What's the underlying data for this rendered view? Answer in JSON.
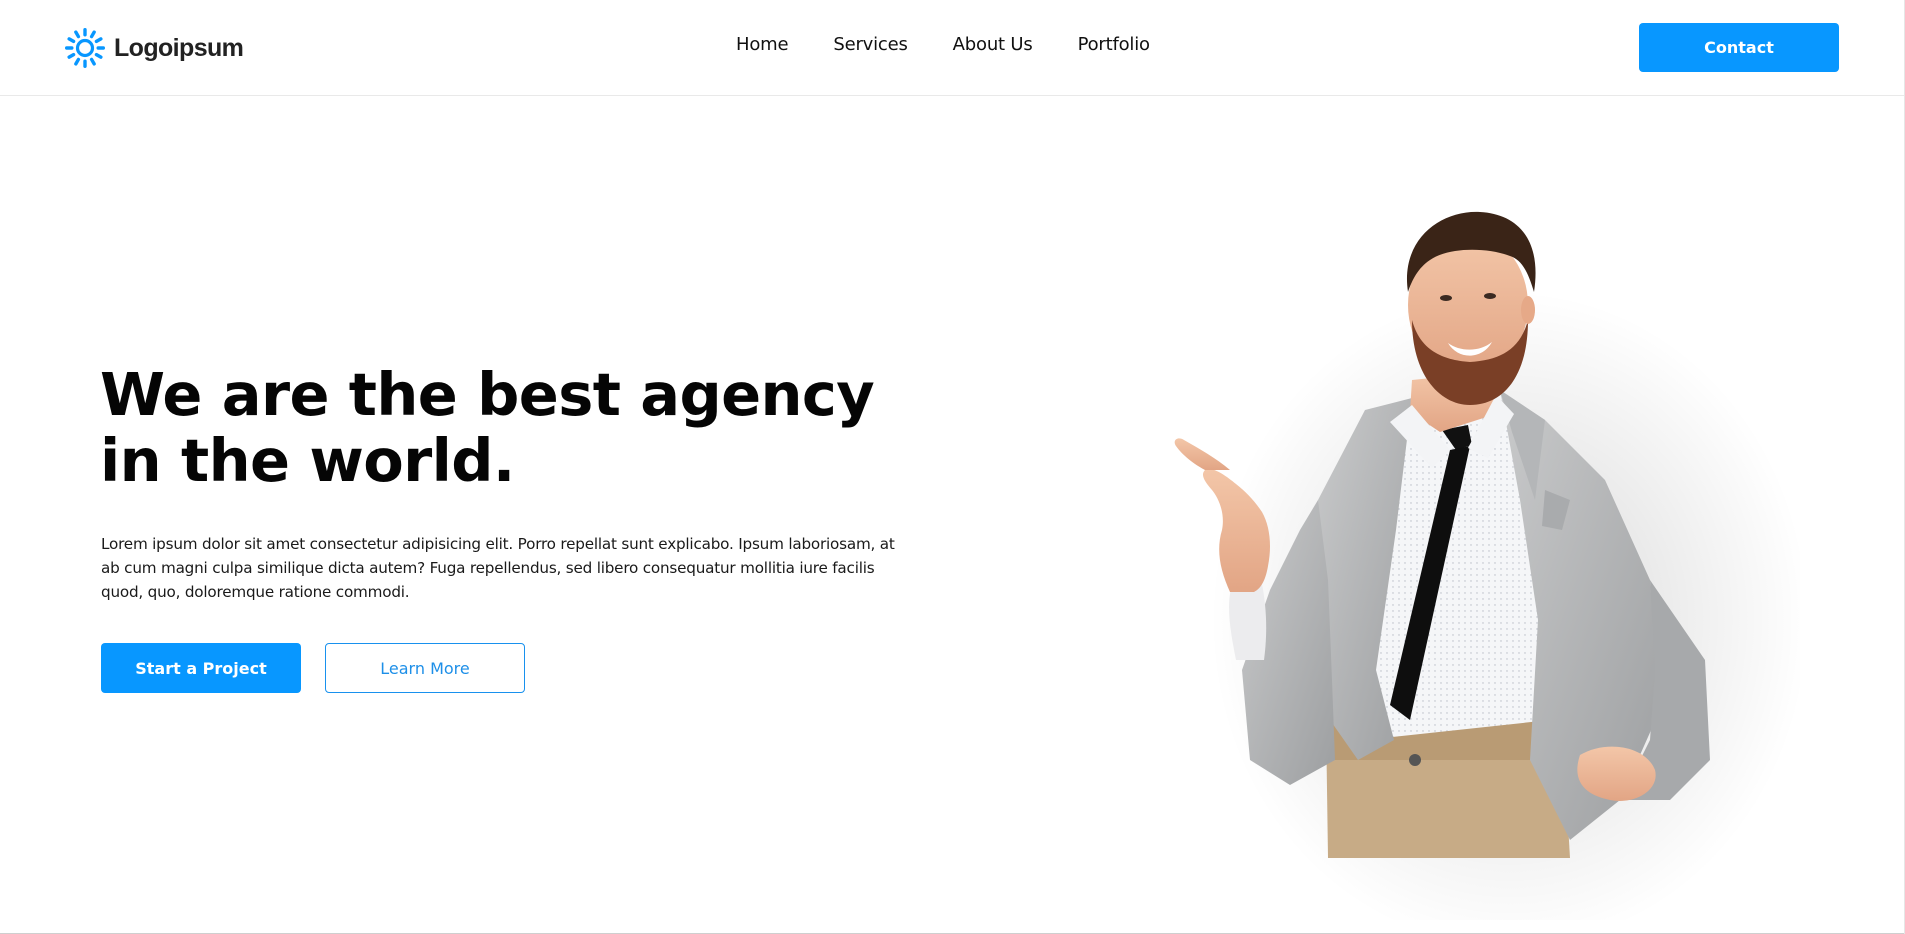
{
  "brand": {
    "name": "Logoipsum",
    "accent": "#0897ff",
    "icon": "sunburst-logo-icon"
  },
  "nav": {
    "items": [
      {
        "label": "Home"
      },
      {
        "label": "Services"
      },
      {
        "label": "About Us"
      },
      {
        "label": "Portfolio"
      }
    ],
    "contact_label": "Contact"
  },
  "hero": {
    "title": "We are the best agency in the world.",
    "text": "Lorem ipsum dolor sit amet consectetur adipisicing elit. Porro repellat sunt explicabo. Ipsum laboriosam, at ab cum magni culpa similique dicta autem? Fuga repellendus, sed libero consequatur mollitia iure facilis quod, quo, doloremque ratione commodi.",
    "primary_button": "Start a Project",
    "secondary_button": "Learn More",
    "image": "man-in-suit-pointing-illustration"
  }
}
